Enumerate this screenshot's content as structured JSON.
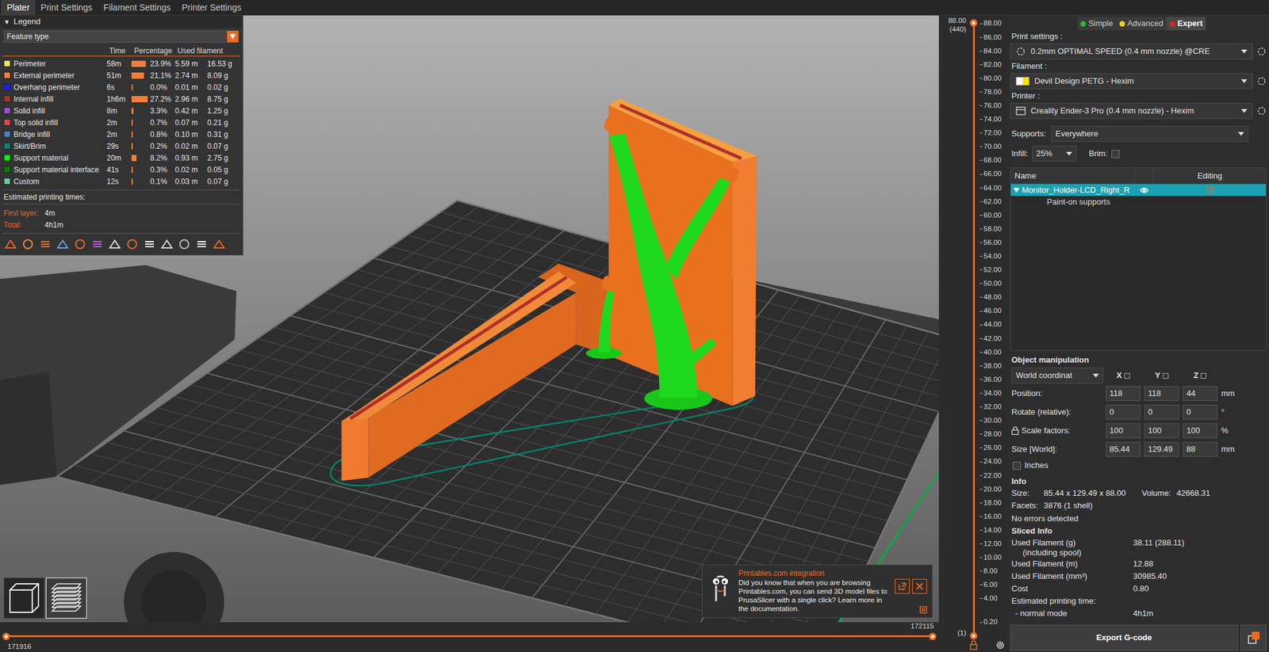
{
  "tabs": [
    {
      "label": "Plater",
      "selected": true
    },
    {
      "label": "Print Settings",
      "selected": false
    },
    {
      "label": "Filament Settings",
      "selected": false
    },
    {
      "label": "Printer Settings",
      "selected": false
    }
  ],
  "legend": {
    "expander": "▼",
    "title": "Legend",
    "view_type": "Feature type",
    "columns": [
      "Time",
      "Percentage",
      "Used filament"
    ],
    "rows": [
      {
        "name": "Perimeter",
        "time": "58m",
        "percentage": "23.9%",
        "level": 0.88,
        "length": "5.59 m",
        "weight": "16.53 g",
        "color": "#ffe64d"
      },
      {
        "name": "External perimeter",
        "time": "51m",
        "percentage": "21.1%",
        "level": 0.78,
        "length": "2.74 m",
        "weight": "8.09 g",
        "color": "#ff7d38"
      },
      {
        "name": "Overhang perimeter",
        "time": "6s",
        "percentage": "0.0%",
        "level": 0.0,
        "length": "0.01 m",
        "weight": "0.02 g",
        "color": "#1f1fff"
      },
      {
        "name": "Internal infill",
        "time": "1h6m",
        "percentage": "27.2%",
        "level": 1.0,
        "length": "2.96 m",
        "weight": "8.75 g",
        "color": "#b03029"
      },
      {
        "name": "Solid infill",
        "time": "8m",
        "percentage": "3.3%",
        "level": 0.12,
        "length": "0.42 m",
        "weight": "1.25 g",
        "color": "#9654cc"
      },
      {
        "name": "Top solid infill",
        "time": "2m",
        "percentage": "0.7%",
        "level": 0.03,
        "length": "0.07 m",
        "weight": "0.21 g",
        "color": "#f04040"
      },
      {
        "name": "Bridge infill",
        "time": "2m",
        "percentage": "0.8%",
        "level": 0.03,
        "length": "0.10 m",
        "weight": "0.31 g",
        "color": "#4d80ba"
      },
      {
        "name": "Skirt/Brim",
        "time": "29s",
        "percentage": "0.2%",
        "level": 0.01,
        "length": "0.02 m",
        "weight": "0.07 g",
        "color": "#00876e"
      },
      {
        "name": "Support material",
        "time": "20m",
        "percentage": "8.2%",
        "level": 0.3,
        "length": "0.93 m",
        "weight": "2.75 g",
        "color": "#00ff00"
      },
      {
        "name": "Support material interface",
        "time": "41s",
        "percentage": "0.3%",
        "level": 0.01,
        "length": "0.02 m",
        "weight": "0.05 g",
        "color": "#008000"
      },
      {
        "name": "Custom",
        "time": "12s",
        "percentage": "0.1%",
        "level": 0.0,
        "length": "0.03 m",
        "weight": "0.07 g",
        "color": "#5ed194"
      }
    ],
    "times_title": "Estimated printing times:",
    "times": [
      {
        "label": "First layer:",
        "value": "4m"
      },
      {
        "label": "Total:",
        "value": "4h1m"
      }
    ]
  },
  "view_toggles": [
    {
      "kind": "3d",
      "selected": false
    },
    {
      "kind": "preview",
      "selected": true
    }
  ],
  "notification": {
    "title": "Printables.com integration",
    "body": "Did you know that when you are browsing Printables.com, you can send 3D model files to PrusaSlicer with a single click? Learn more in the documentation."
  },
  "horizontal_slider": {
    "high_label": "172115",
    "low_label": "171916",
    "level_low": 0,
    "level_high": 1
  },
  "vertical_slider": {
    "top_value": "88.00",
    "top_layer": "(440)",
    "ticks": [
      "88.00",
      "86.00",
      "84.00",
      "82.00",
      "80.00",
      "78.00",
      "76.00",
      "74.00",
      "72.00",
      "70.00",
      "68.00",
      "66.00",
      "64.00",
      "62.00",
      "60.00",
      "58.00",
      "56.00",
      "54.00",
      "52.00",
      "50.00",
      "48.00",
      "46.00",
      "44.00",
      "42.00",
      "40.00",
      "38.00",
      "36.00",
      "34.00",
      "32.00",
      "30.00",
      "28.00",
      "26.00",
      "24.00",
      "22.00",
      "20.00",
      "18.00",
      "16.00",
      "14.00",
      "12.00",
      "10.00",
      "8.00",
      "6.00",
      "4.00"
    ],
    "bottom_value": "0.20",
    "bottom_layer": "(1)",
    "level_low": 0,
    "level_high": 1
  },
  "sidebar": {
    "modes": [
      {
        "label": "Simple",
        "selected": false,
        "color": "#2fb52f"
      },
      {
        "label": "Advanced",
        "selected": false,
        "color": "#e8d31f"
      },
      {
        "label": "Expert",
        "selected": true,
        "color": "#e02020"
      }
    ],
    "presets": [
      {
        "label": "Print settings :",
        "value": "0.2mm OPTIMAL SPEED (0.4 mm nozzle) @CRE",
        "kind": "print"
      },
      {
        "label": "Filament :",
        "value": "Devil Design PETG - Hexim",
        "kind": "filament",
        "color": "#f5e11a"
      },
      {
        "label": "Printer :",
        "value": "Creality Ender-3 Pro (0.4 mm nozzle) - Hexim",
        "kind": "printer"
      }
    ],
    "supports": {
      "label": "Supports:",
      "value": "Everywhere"
    },
    "infill": {
      "label": "Infill:",
      "value": "25%"
    },
    "brim": {
      "label": "Brim:",
      "checked": false
    },
    "object_list": {
      "columns": [
        "Name",
        "Editing"
      ],
      "rows": [
        {
          "name": "Monitor_Holder-LCD_Right_R",
          "kind": "object",
          "expanded": true,
          "selected": true
        },
        {
          "name": "Paint-on supports",
          "kind": "paint",
          "expanded": false,
          "selected": false
        }
      ]
    },
    "manipulation": {
      "title": "Object manipulation",
      "coordinates": "World coordinat",
      "axes": [
        "X",
        "Y",
        "Z"
      ],
      "rows": [
        {
          "label": "Position:",
          "values": [
            "118",
            "118",
            "44"
          ],
          "unit": "mm",
          "locked": false
        },
        {
          "label": "Rotate (relative):",
          "values": [
            "0",
            "0",
            "0"
          ],
          "unit": "°",
          "locked": false
        },
        {
          "label": "Scale factors:",
          "values": [
            "100",
            "100",
            "100"
          ],
          "unit": "%",
          "locked": true
        },
        {
          "label": "Size [World]:",
          "values": [
            "85.44",
            "129.49",
            "88"
          ],
          "unit": "mm",
          "locked": false
        }
      ],
      "inches": {
        "label": "Inches",
        "checked": false
      }
    },
    "info": {
      "title": "Info",
      "size_label": "Size:",
      "size": "85.44 x 129.49 x 88.00",
      "volume_label": "Volume:",
      "volume": "42668.31",
      "facets_label": "Facets:",
      "facets": "3876 (1 shell)",
      "status": "No errors detected"
    },
    "sliced_info": {
      "title": "Sliced Info",
      "rows": [
        {
          "label": "Used Filament (g)",
          "note": "(including spool)",
          "value": "38.11 (288.11)",
          "kind": "main"
        },
        {
          "label": "Used Filament (m)",
          "note": "",
          "value": "12.88",
          "kind": "main"
        },
        {
          "label": "Used Filament (mm³)",
          "note": "",
          "value": "30985.40",
          "kind": "main"
        },
        {
          "label": "Cost",
          "note": "",
          "value": "0.80",
          "kind": "main"
        },
        {
          "label": "Estimated printing time:",
          "note": "",
          "value": "",
          "kind": "main"
        },
        {
          "label": "- normal mode",
          "note": "",
          "value": "4h1m",
          "kind": "sub"
        }
      ]
    },
    "export_button": "Export G-code"
  }
}
